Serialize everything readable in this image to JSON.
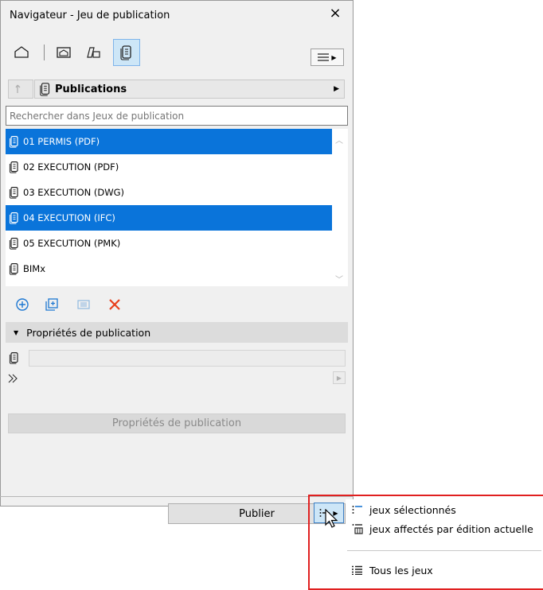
{
  "window": {
    "title": "Navigateur - Jeu de publication",
    "close": "×"
  },
  "toolbar": {
    "views": [
      "project-map-icon",
      "view-map-icon",
      "layout-book-icon",
      "publisher-sets-icon"
    ],
    "menu_icon": "hamburger-menu-icon"
  },
  "breadcrumb": {
    "label": "Publications"
  },
  "search": {
    "placeholder": "Rechercher dans Jeux de publication"
  },
  "sets": [
    {
      "label": "01 PERMIS (PDF)",
      "selected": true
    },
    {
      "label": "02 EXECUTION (PDF)",
      "selected": false
    },
    {
      "label": "03 EXECUTION (DWG)",
      "selected": false
    },
    {
      "label": "04 EXECUTION (IFC)",
      "selected": true
    },
    {
      "label": "05 EXECUTION (PMK)",
      "selected": false
    },
    {
      "label": "BIMx",
      "selected": false
    }
  ],
  "actions": [
    "add-icon",
    "add-folder-icon",
    "settings-icon",
    "delete-icon"
  ],
  "properties": {
    "section_title": "Propriétés de publication",
    "button_label": "Propriétés de publication"
  },
  "footer": {
    "publish_label": "Publier"
  },
  "popup_menu": {
    "items": [
      {
        "label": "jeux sélectionnés",
        "icon": "selected-sets-icon"
      },
      {
        "label": "jeux affectés par édition actuelle",
        "icon": "affected-sets-icon"
      },
      {
        "label": "Tous les jeux",
        "icon": "all-sets-icon"
      }
    ]
  },
  "colors": {
    "selection": "#0a74da",
    "highlight": "#cde6f7",
    "delete": "#e8401c",
    "add": "#1e78d2",
    "annotation": "#e02020"
  }
}
